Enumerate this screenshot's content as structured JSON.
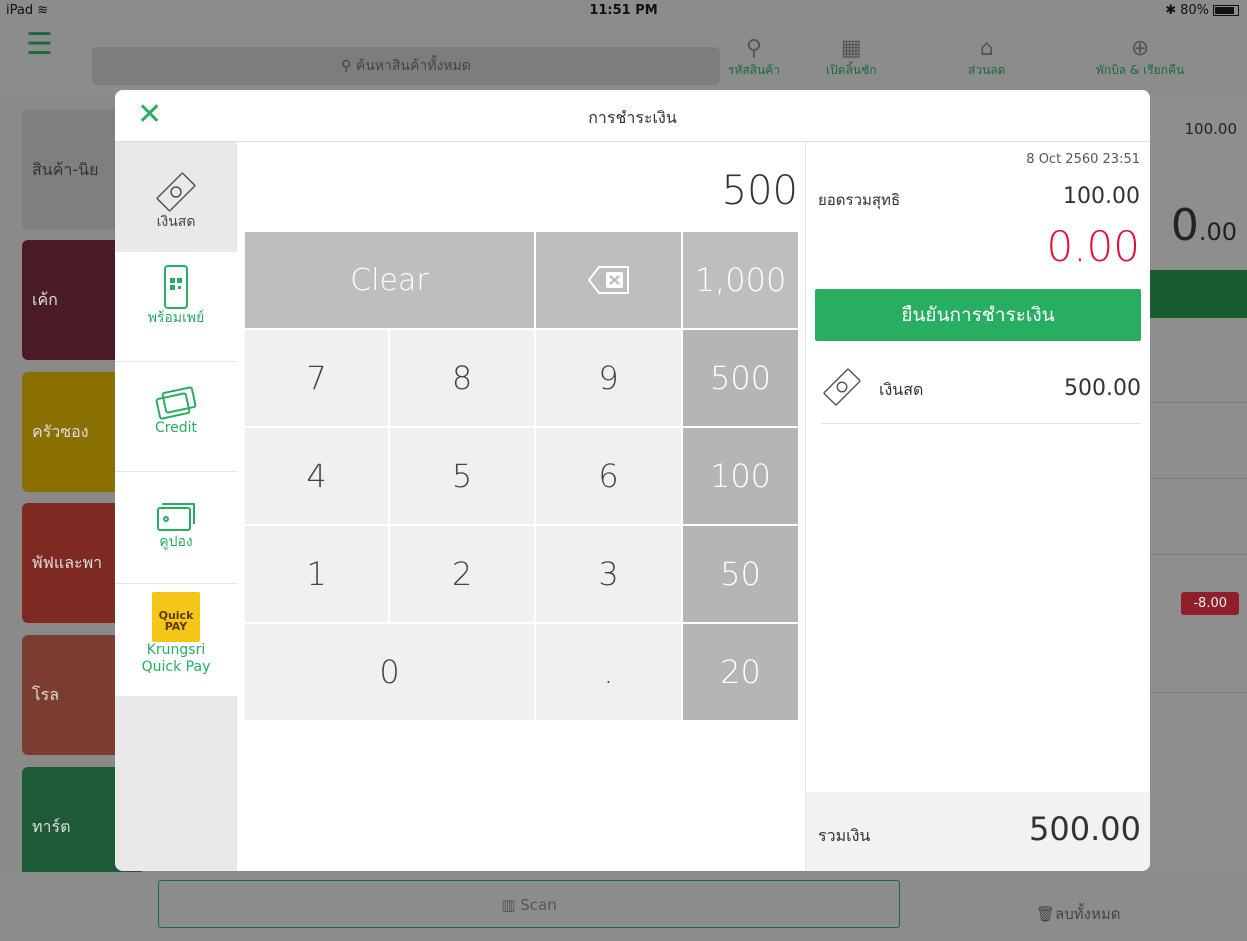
{
  "statusbar": {
    "device": "iPad",
    "time": "11:51 PM",
    "battery": "80%"
  },
  "background": {
    "search_placeholder": "ค้นหาสินค้าทั้งหมด",
    "tools": [
      "รหัสสินค้า",
      "เปิดลิ้นชัก",
      "ส่วนลด",
      "พักบิล & เรียกคืน"
    ],
    "categories": [
      "สินค้า-นิย",
      "เค้ก",
      "ครัวซอง",
      "พัฟและพา",
      "โรล",
      "ทาร์ต"
    ],
    "order_amount": "100.00",
    "order_big_int": "0",
    "order_big_dec": ".00",
    "discount_badge": "-8.00",
    "scan_label": "Scan",
    "delete_all_label": "ลบทั้งหมด"
  },
  "modal": {
    "title": "การชำระเงิน",
    "methods": [
      {
        "label": "เงินสด",
        "icon": "cash-icon",
        "active": true
      },
      {
        "label": "พร้อมเพย์",
        "icon": "qr-phone-icon",
        "active": false
      },
      {
        "label": "Credit",
        "icon": "credit-card-icon",
        "active": false
      },
      {
        "label": "คูปอง",
        "icon": "coupon-icon",
        "active": false
      },
      {
        "label": "Krungsri Quick Pay",
        "icon": "krungsri-quickpay-logo",
        "active": false
      }
    ],
    "quickpay_logo_text": "Quick PAY",
    "amount_input": "500",
    "keypad": {
      "clear": "Clear",
      "k1000": "1,000",
      "k7": "7",
      "k8": "8",
      "k9": "9",
      "k500": "500",
      "k4": "4",
      "k5": "5",
      "k6": "6",
      "k100": "100",
      "k1": "1",
      "k2": "2",
      "k3": "3",
      "k50": "50",
      "k0": "0",
      "kdot": ".",
      "k20": "20"
    },
    "summary": {
      "date": "8 Oct 2560 23:51",
      "net_label": "ยอดรวมสุทธิ",
      "net_value": "100.00",
      "change": "0.00",
      "confirm_label": "ยืนยันการชำระเงิน",
      "payment_label": "เงินสด",
      "payment_value": "500.00",
      "total_label": "รวมเงิน",
      "total_value": "500.00"
    }
  },
  "colors": {
    "accent": "#27ae60",
    "change_red": "#e0103a"
  }
}
